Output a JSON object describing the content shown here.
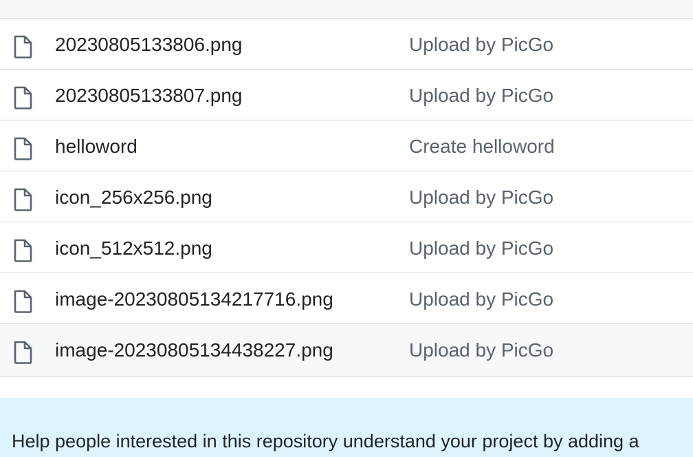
{
  "files": [
    {
      "name": "20230805133806.png",
      "commit": "Upload by PicGo",
      "icon": "file-icon"
    },
    {
      "name": "20230805133807.png",
      "commit": "Upload by PicGo",
      "icon": "file-icon"
    },
    {
      "name": "helloword",
      "commit": "Create helloword",
      "icon": "file-icon"
    },
    {
      "name": "icon_256x256.png",
      "commit": "Upload by PicGo",
      "icon": "file-icon"
    },
    {
      "name": "icon_512x512.png",
      "commit": "Upload by PicGo",
      "icon": "file-icon"
    },
    {
      "name": "image-20230805134217716.png",
      "commit": "Upload by PicGo",
      "icon": "file-icon"
    },
    {
      "name": "image-20230805134438227.png",
      "commit": "Upload by PicGo",
      "icon": "file-icon"
    }
  ],
  "readme_banner": {
    "text": "Help people interested in this repository understand your project by adding a"
  },
  "colors": {
    "border": "#d0d7de",
    "muted_text": "#59636e",
    "banner_bg": "#ddf4ff",
    "hover_row_bg": "#f6f8fa"
  }
}
